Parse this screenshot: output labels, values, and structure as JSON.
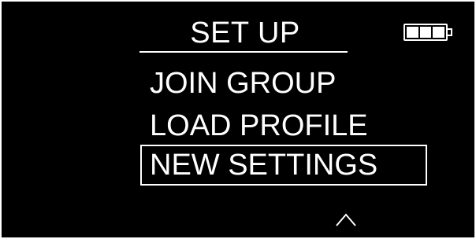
{
  "header": {
    "title": "SET UP"
  },
  "battery": {
    "icon": "battery-icon",
    "level_bars": 3,
    "max_bars": 3
  },
  "menu": {
    "items": [
      {
        "label": "JOIN GROUP",
        "selected": false
      },
      {
        "label": "LOAD PROFILE",
        "selected": false
      },
      {
        "label": "NEW SETTINGS",
        "selected": true
      }
    ]
  },
  "navigation": {
    "scroll_indicator_icon": "chevron-up-icon"
  },
  "colors": {
    "background": "#000000",
    "foreground": "#ffffff"
  }
}
